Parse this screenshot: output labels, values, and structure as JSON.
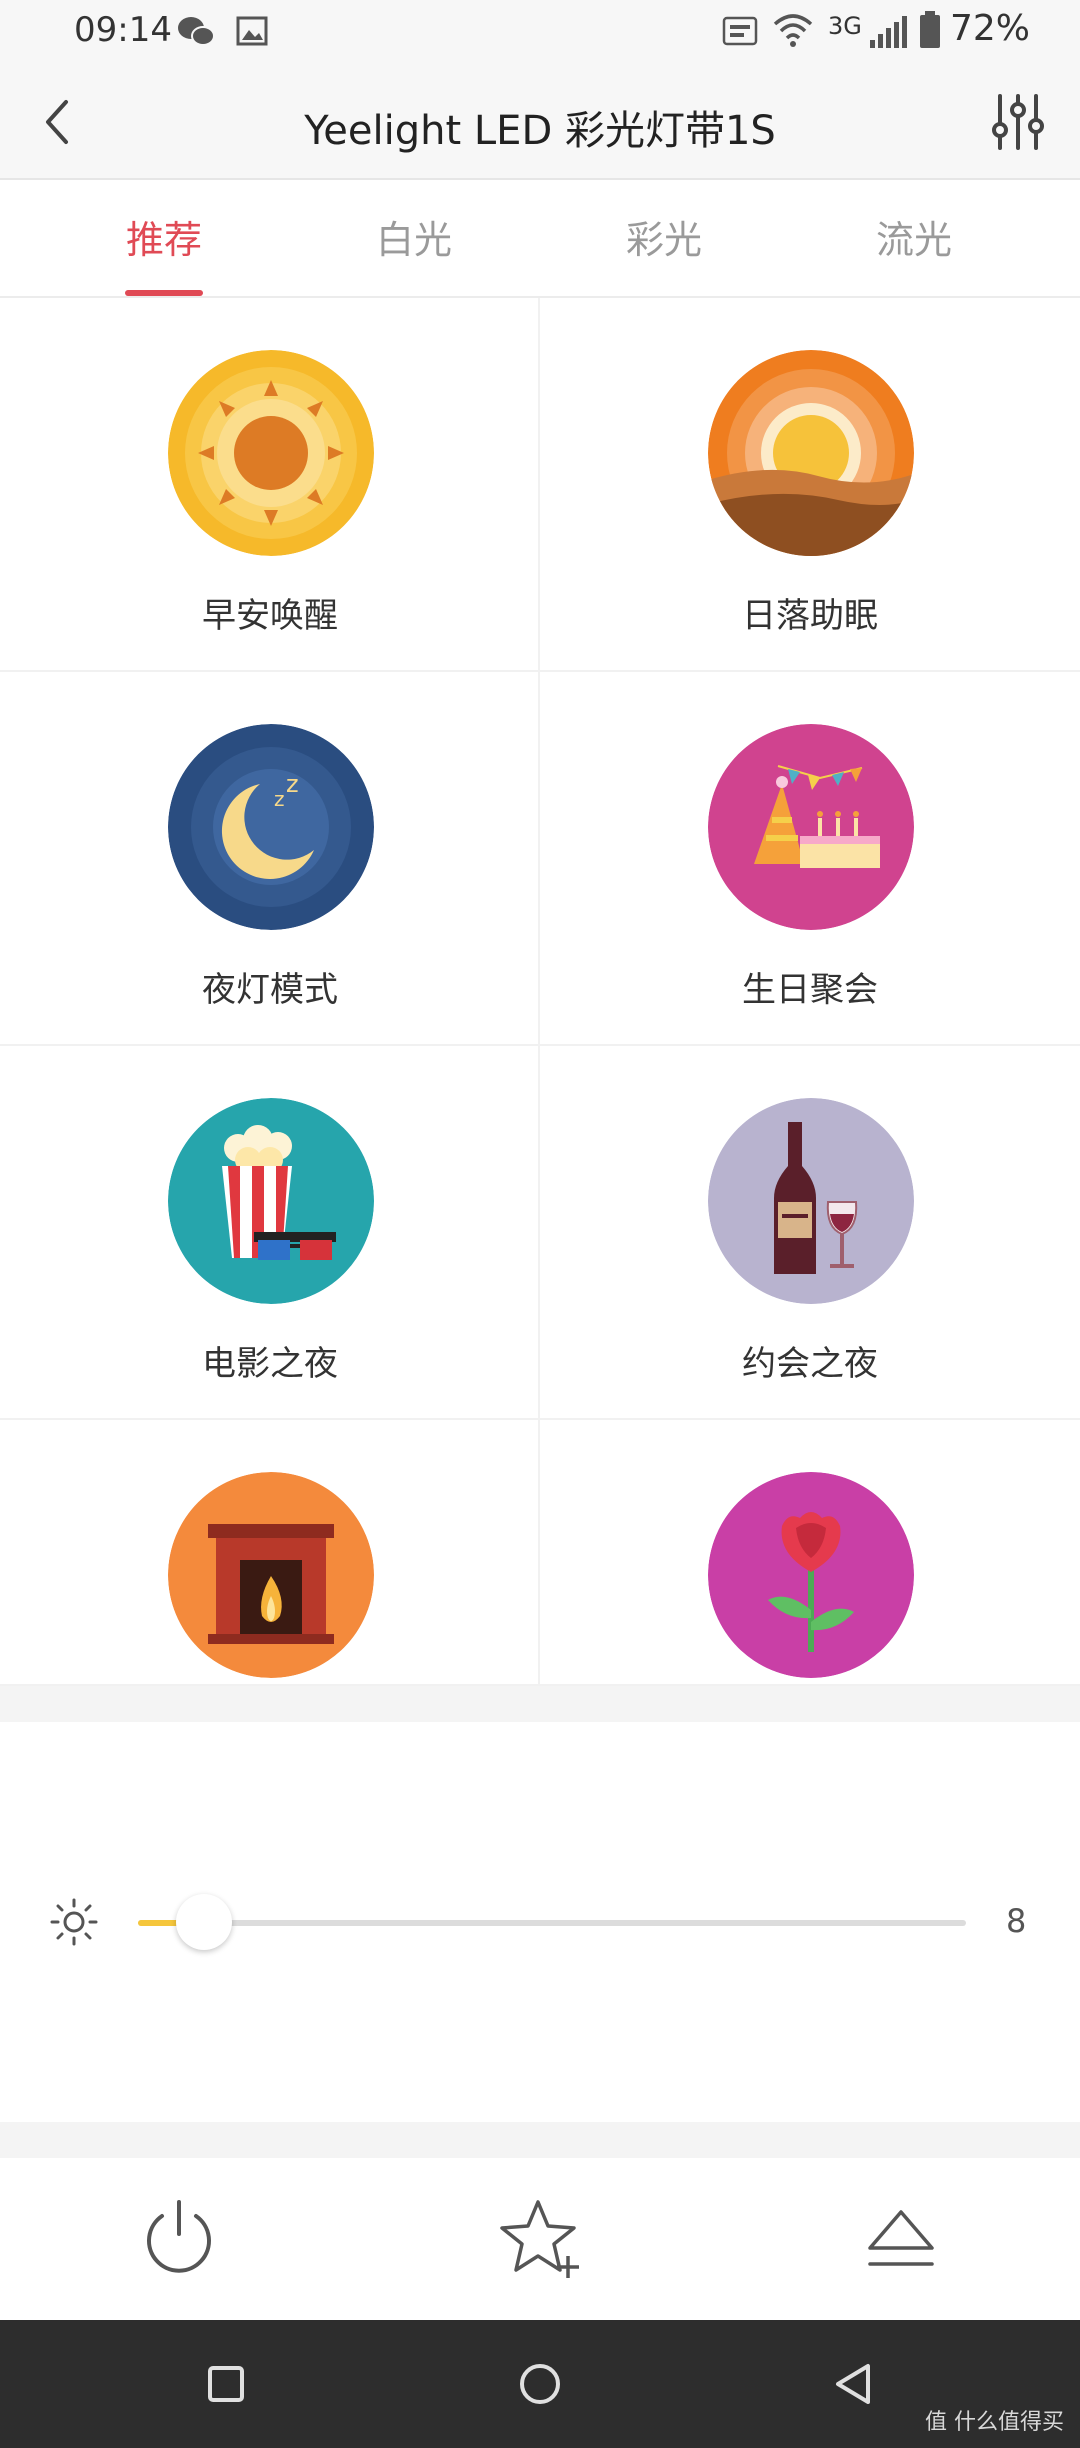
{
  "status_bar": {
    "time": "09:14",
    "network": "3G",
    "battery": "72%"
  },
  "header": {
    "title": "Yeelight LED 彩光灯带1S"
  },
  "tabs": [
    {
      "label": "推荐",
      "active": true
    },
    {
      "label": "白光",
      "active": false
    },
    {
      "label": "彩光",
      "active": false
    },
    {
      "label": "流光",
      "active": false
    }
  ],
  "scenes": [
    {
      "label": "早安唤醒",
      "icon": "sun-icon"
    },
    {
      "label": "日落助眠",
      "icon": "sunset-icon"
    },
    {
      "label": "夜灯模式",
      "icon": "moon-icon"
    },
    {
      "label": "生日聚会",
      "icon": "birthday-party-icon"
    },
    {
      "label": "电影之夜",
      "icon": "popcorn-icon"
    },
    {
      "label": "约会之夜",
      "icon": "wine-icon"
    },
    {
      "label": "",
      "icon": "fireplace-icon"
    },
    {
      "label": "",
      "icon": "rose-icon"
    }
  ],
  "brightness": {
    "value": "8",
    "fraction": 0.08,
    "accent": "#f5c63c"
  },
  "colors": {
    "accent": "#e04a55",
    "navbar": "#2d2d2d"
  },
  "watermark": "值 什么值得买"
}
